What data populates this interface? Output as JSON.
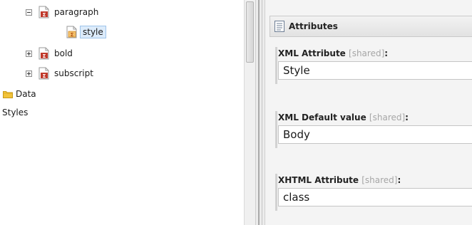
{
  "tree": {
    "nodes": [
      {
        "label": "paragraph",
        "icon": "xml-element-icon",
        "expander": "minus"
      },
      {
        "label": "style",
        "icon": "xml-attribute-icon",
        "selected": true
      },
      {
        "label": "bold",
        "icon": "xml-element-icon",
        "expander": "plus"
      },
      {
        "label": "subscript",
        "icon": "xml-element-icon",
        "expander": "plus"
      },
      {
        "label": "Data",
        "icon": "folder-icon"
      },
      {
        "label": "Styles"
      }
    ]
  },
  "attributes": {
    "header_title": "Attributes",
    "fields": [
      {
        "label": "XML Attribute",
        "shared": "[shared]",
        "colon": ":",
        "value": "Style"
      },
      {
        "label": "XML Default value",
        "shared": "[shared]",
        "colon": ":",
        "value": "Body"
      },
      {
        "label": "XHTML Attribute",
        "shared": "[shared]",
        "colon": ":",
        "value": "class"
      }
    ]
  },
  "colors": {
    "selection_bg": "#dcebfa",
    "element_icon_red": "#c0392b",
    "folder_yellow": "#f2c33a"
  }
}
